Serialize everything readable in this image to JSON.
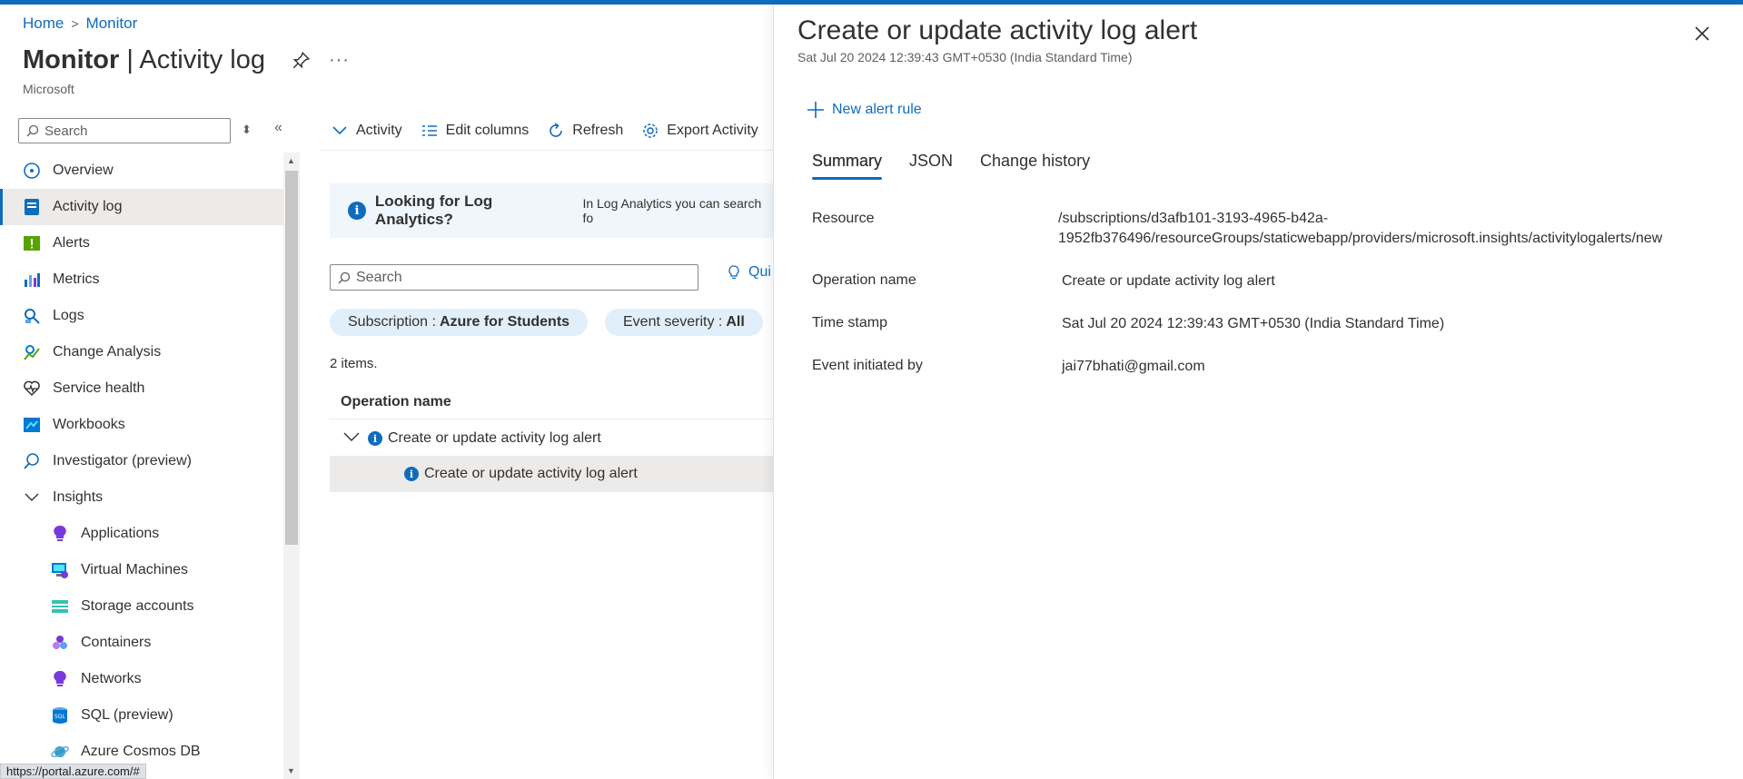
{
  "breadcrumb": {
    "home": "Home",
    "monitor": "Monitor"
  },
  "header": {
    "title_bold": "Monitor",
    "title_rest": " | Activity log",
    "subtitle": "Microsoft"
  },
  "sidebar": {
    "search_placeholder": "Search",
    "items": [
      {
        "label": "Overview",
        "icon": "overview-icon"
      },
      {
        "label": "Activity log",
        "icon": "activity-log-icon",
        "active": true
      },
      {
        "label": "Alerts",
        "icon": "alerts-icon"
      },
      {
        "label": "Metrics",
        "icon": "metrics-icon"
      },
      {
        "label": "Logs",
        "icon": "logs-icon"
      },
      {
        "label": "Change Analysis",
        "icon": "change-analysis-icon"
      },
      {
        "label": "Service health",
        "icon": "service-health-icon"
      },
      {
        "label": "Workbooks",
        "icon": "workbooks-icon"
      },
      {
        "label": "Investigator (preview)",
        "icon": "investigator-icon"
      },
      {
        "label": "Insights",
        "icon": "chevron-down-icon"
      },
      {
        "label": "Applications",
        "icon": "applications-icon"
      },
      {
        "label": "Virtual Machines",
        "icon": "virtual-machines-icon"
      },
      {
        "label": "Storage accounts",
        "icon": "storage-accounts-icon"
      },
      {
        "label": "Containers",
        "icon": "containers-icon"
      },
      {
        "label": "Networks",
        "icon": "networks-icon"
      },
      {
        "label": "SQL (preview)",
        "icon": "sql-icon"
      },
      {
        "label": "Azure Cosmos DB",
        "icon": "cosmos-db-icon"
      }
    ]
  },
  "status_url": "https://portal.azure.com/#",
  "toolbar": {
    "activity": "Activity",
    "edit_columns": "Edit columns",
    "refresh": "Refresh",
    "export": "Export Activity"
  },
  "banner": {
    "bold": "Looking for Log Analytics?",
    "text": "In Log Analytics you can search fo"
  },
  "main": {
    "search_placeholder": "Search",
    "quick": "Qui",
    "filter_subscription_label": "Subscription :",
    "filter_subscription_value": "Azure for Students",
    "filter_severity_label": "Event severity :",
    "filter_severity_value": "All",
    "items_count": "2 items.",
    "column_header": "Operation name",
    "rows": [
      "Create or update activity log alert",
      "Create or update activity log alert"
    ]
  },
  "panel": {
    "title": "Create or update activity log alert",
    "timestamp": "Sat Jul 20 2024 12:39:43 GMT+0530 (India Standard Time)",
    "new_alert": "New alert rule",
    "tabs": [
      "Summary",
      "JSON",
      "Change history"
    ],
    "props": {
      "resource_label": "Resource",
      "resource_line1": "/subscriptions/d3afb101-3193-4965-b42a-",
      "resource_line2": "1952fb376496/resourceGroups/staticwebapp/providers/microsoft.insights/activitylogalerts/new",
      "operation_label": "Operation name",
      "operation_value": "Create or update activity log alert",
      "timestamp_label": "Time stamp",
      "timestamp_value": "Sat Jul 20 2024 12:39:43 GMT+0530 (India Standard Time)",
      "initiated_label": "Event initiated by",
      "initiated_value": "jai77bhati@gmail.com"
    }
  },
  "colors": {
    "accent": "#0f6cbd",
    "selected_bg": "#edebe9",
    "banner_bg": "#eff6fc",
    "pill_bg": "#e1effa"
  }
}
